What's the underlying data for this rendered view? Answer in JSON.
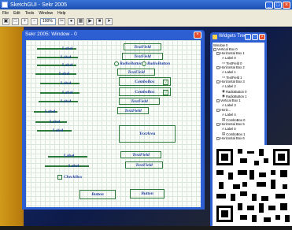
{
  "app": {
    "title": "SketchGUI - Sekr 2005",
    "menu": [
      "File",
      "Edit",
      "Tools",
      "Window",
      "Help"
    ],
    "zoom": "100%"
  },
  "sketch": {
    "window_title": "Sekr 2005: Window - 0",
    "labels": {
      "l1": "Label",
      "l2": "Label",
      "l3": "Label",
      "l4": "Label",
      "l5": "Label",
      "l6": "Label",
      "l7": "Label",
      "l8": "Label",
      "l9": "Label",
      "l10": "Label",
      "l11": "Label",
      "l12": "Label"
    },
    "textfields": {
      "tf1": "TextField",
      "tf2": "TextField",
      "tf3": "TextField",
      "tf4": "TextField",
      "tf5": "TextField",
      "tf6": "TextField",
      "tf7": "TextField"
    },
    "radios": {
      "r1": "RadioButton",
      "r2": "RadioButton"
    },
    "combos": {
      "c1": "ComboBox",
      "c2": "ComboBox"
    },
    "textarea": "TextArea",
    "checkbox": "CheckBox",
    "buttons": {
      "b1": "Button",
      "b2": "Button"
    }
  },
  "tree": {
    "title": "Widgets Tree",
    "rows": [
      "Window 0",
      "Vertical Box 0",
      "Horizontal Box 1",
      "Label 0",
      "TextField 0",
      "Horizontal Box 2",
      "Label 1",
      "TextField 1",
      "Horizontal Box 3",
      "Label 2",
      "RadioButton 0",
      "RadioButton 1",
      "Vertical Box 1",
      "Label 3",
      "Horiz...",
      "Label 4",
      "ComboBox 0",
      "Horizontal Box 5",
      "Label 5",
      "ComboBox 1",
      "Horizontal Box 6"
    ]
  }
}
